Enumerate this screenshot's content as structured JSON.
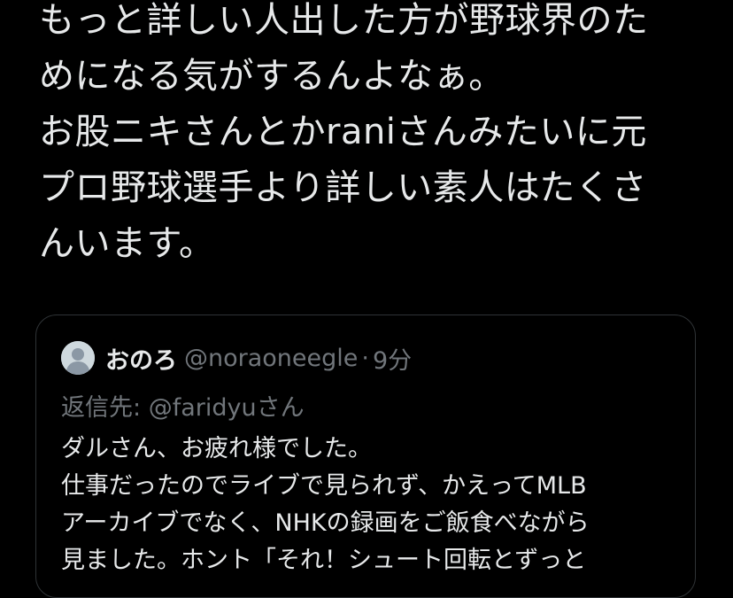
{
  "tweet": {
    "lines": [
      "もっと詳しい人出した方が野球界のた",
      "めになる気がするんよなぁ。",
      "お股ニキさんとかraniさんみたいに元",
      "プロ野球選手より詳しい素人はたくさ",
      "んいます。"
    ]
  },
  "quote": {
    "display_name": "おのろ",
    "handle": "@noraoneegle",
    "separator": "·",
    "time": "9分",
    "reply_prefix": "返信先: ",
    "reply_to": "@faridyu",
    "reply_suffix": "さん",
    "lines": [
      "ダルさん、お疲れ様でした。",
      "仕事だったのでライブで見られず、かえってMLB",
      "アーカイブでなく、NHKの録画をご飯食べながら",
      "見ました。ホント「それ！シュート回転とずっと"
    ]
  },
  "colors": {
    "background": "#000000",
    "text_primary": "#e7e9ea",
    "text_secondary": "#71767b",
    "border": "#2f3336"
  },
  "icons": {
    "avatar": "default-avatar-icon"
  }
}
